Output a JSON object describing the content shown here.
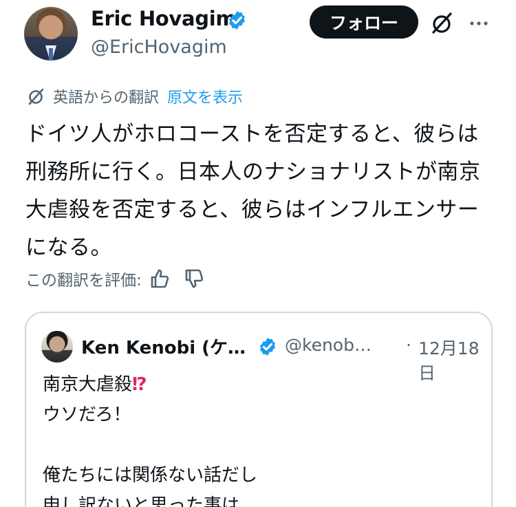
{
  "tweet": {
    "author_name": "Eric Hovagim",
    "author_handle": "@EricHovagim",
    "follow_label": "フォロー",
    "translated_label": "英語からの翻訳",
    "show_original_label": "原文を表示",
    "text": "ドイツ人がホロコーストを否定すると、彼らは\n刑務所に行く。日本人のナショナリストが南京\n大虐殺を否定すると、彼らはインフルエンサー\nになる。",
    "rate_label": "この翻訳を評価:"
  },
  "quote": {
    "author_name": "Ken Kenobi (ケ…",
    "author_handle": "@kenob…",
    "separator": "·",
    "date": "12月18日",
    "text_line1": "南京大虐殺",
    "text_emoji": "⁉",
    "text_rest": "ウソだろ！\n\n俺たちには関係ない話だし\n申し訳ないと思った事は"
  },
  "colors": {
    "verified_blue": "#1d9bf0",
    "secondary_text": "#536471",
    "link_blue": "#1d9bf0",
    "follow_bg": "#0f1419"
  },
  "icons": {
    "verified": "verified-badge-icon",
    "grok": "grok-icon",
    "more": "more-options-icon",
    "translate": "translate-icon",
    "thumbs_up": "thumbs-up-icon",
    "thumbs_down": "thumbs-down-icon"
  }
}
